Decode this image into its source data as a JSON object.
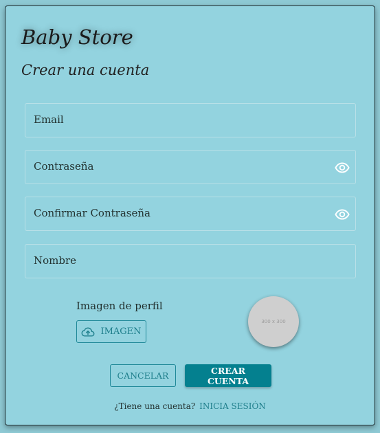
{
  "brand": "Baby Store",
  "subtitle": "Crear una cuenta",
  "fields": {
    "email": {
      "label": "Email"
    },
    "password": {
      "label": "Contraseña"
    },
    "confirm": {
      "label": "Confirmar Contraseña"
    },
    "name": {
      "label": "Nombre"
    }
  },
  "profile": {
    "label": "Imagen de perfil",
    "upload_button": "IMAGEN",
    "avatar_placeholder": "300 x 300"
  },
  "actions": {
    "cancel": "CANCELAR",
    "create": "CREAR CUENTA"
  },
  "footer": {
    "prompt": "¿Tiene una cuenta?",
    "link": "INICIA SESIÓN"
  },
  "colors": {
    "background": "#8ec9d4",
    "card": "#93d3df",
    "accent": "#04808f"
  },
  "icons": {
    "password_toggle": "eye-icon",
    "upload": "cloud-upload-icon"
  }
}
